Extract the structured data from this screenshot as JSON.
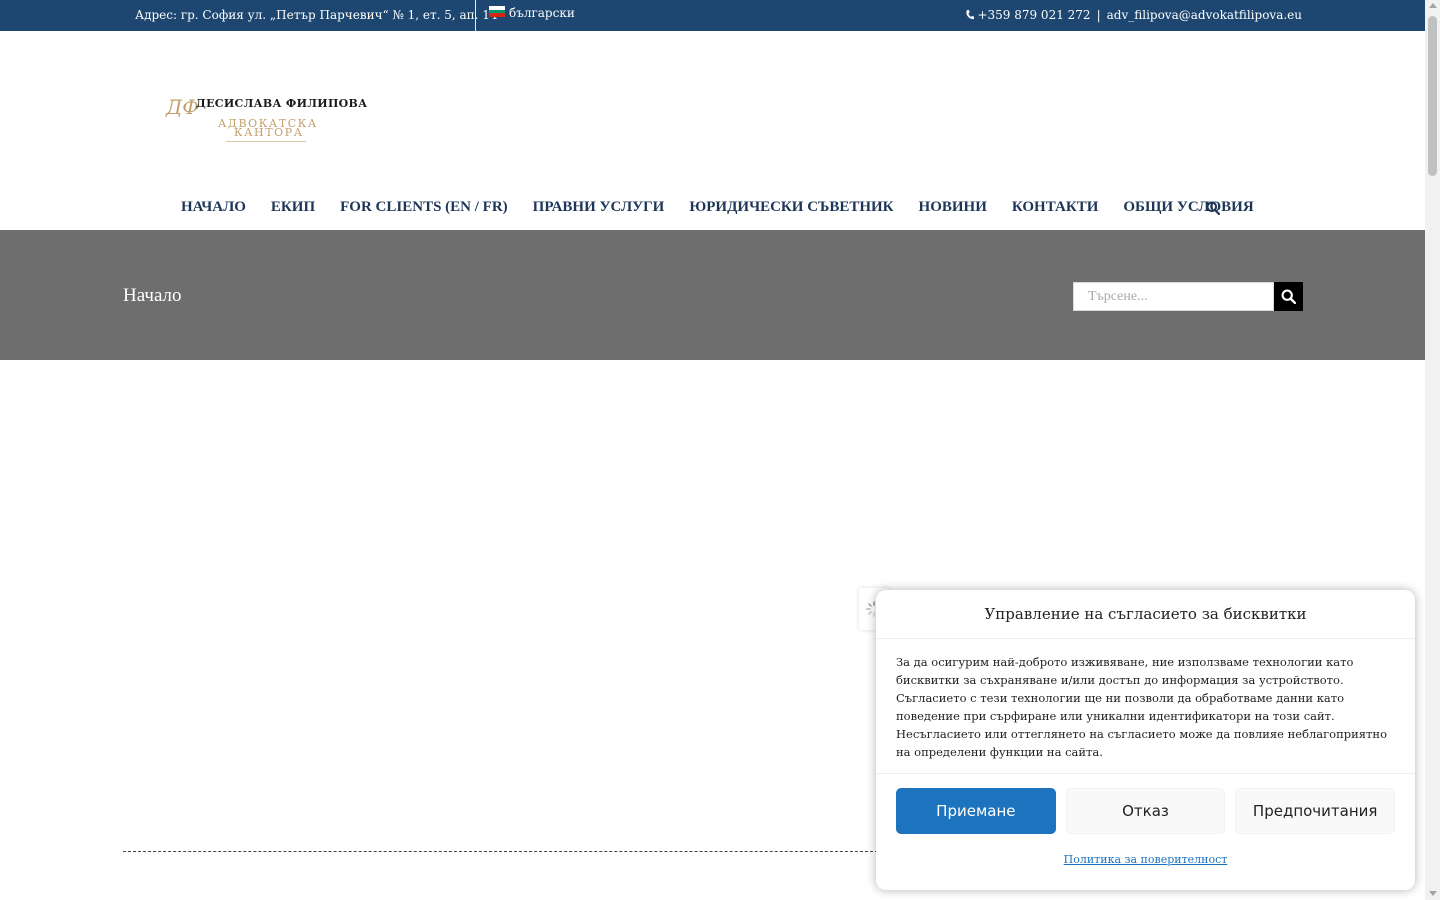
{
  "topbar": {
    "address": "Адрес: гр. София ул. „Петър Парчевич“ № 1, ет. 5, ап. 14",
    "language": "български",
    "phone": "+359 879 021 272",
    "separator": "|",
    "email": "adv_filipova@advokatfilipova.eu",
    "background": "#1d4670"
  },
  "logo": {
    "monogram": "ДФ",
    "name": "ДЕСИСЛАВА ФИЛИПОВА",
    "firm_line1": "АДВОКАТСКА",
    "firm_line2": "КАНТОРА",
    "gold": "#c2a06b"
  },
  "nav": {
    "items": [
      "НАЧАЛО",
      "ЕКИП",
      "FOR CLIENTS (EN / FR)",
      "ПРАВНИ УСЛУГИ",
      "ЮРИДИЧЕСКИ СЪВЕТНИК",
      "НОВИНИ",
      "КОНТАКТИ",
      "ОБЩИ УСЛОВИЯ"
    ],
    "search_icon": "search-icon",
    "color": "#1d3557"
  },
  "page_title_bar": {
    "title": "Начало",
    "search_placeholder": "Търсене...",
    "background": "#6e6e6e"
  },
  "cookie_banner": {
    "title": "Управление на съгласието за бисквитки",
    "body": "За да осигурим най-доброто изживяване, ние използваме технологии като бисквитки за съхраняване и/или достъп до информация за устройството. Съгласието с тези технологии ще ни позволи да обработваме данни като поведение при сърфиране или уникални идентификатори на този сайт. Несъгласието или оттеглянето на съгласието може да повлияе неблагоприятно на определени функции на сайта.",
    "accept_label": "Приемане",
    "deny_label": "Отказ",
    "preferences_label": "Предпочитания",
    "policy_link": "Политика за поверителност",
    "accent": "#1e73be"
  }
}
